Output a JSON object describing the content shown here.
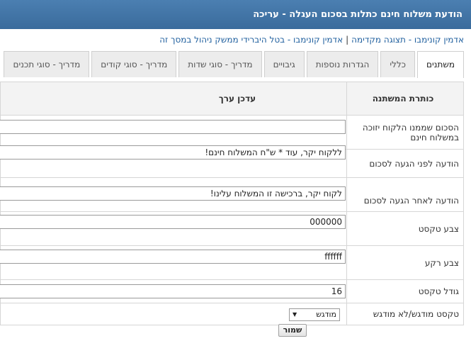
{
  "window": {
    "title": "הודעת משלוח חינם כתלות בסכום העגלה - עריכה"
  },
  "links": [
    "אדמין קונימבו - תצוגה מקדימה",
    "אדמין קונימבו - בטל היברידי ממשק ניהול במסך זה"
  ],
  "tabs": [
    {
      "label": "משתנים",
      "active": true
    },
    {
      "label": "כללי"
    },
    {
      "label": "הגדרות נוספות"
    },
    {
      "label": "גיבויים"
    },
    {
      "label": "מדריך - סוגי שדות"
    },
    {
      "label": "מדריך - סוגי קודים"
    },
    {
      "label": "מדריך - סוגי תכנים"
    }
  ],
  "table": {
    "header_label": "כותרת המשתנה",
    "header_value": "עדכן ערך",
    "rows": [
      {
        "label": "הסכום שממנו הלקוח יזוכה במשלוח חינם",
        "value": ""
      },
      {
        "label": "הודעה לפני הגעה לסכום",
        "value": "ללקוח יקר, עוד * ש\"ח המשלוח חינם!"
      },
      {
        "label": "הודעה לאחר הגעה לסכום",
        "value": "לקוח יקר, ברכישה זו המשלוח עלינו!"
      },
      {
        "label": "צבע טקסט",
        "value": "000000"
      },
      {
        "label": "צבע רקע",
        "value": "ffffff"
      },
      {
        "label": "גודל טקסט",
        "value": "16"
      },
      {
        "label": "טקסט מודגש/לא מודגש",
        "select": "מודגש"
      }
    ]
  },
  "save_label": "שמור"
}
